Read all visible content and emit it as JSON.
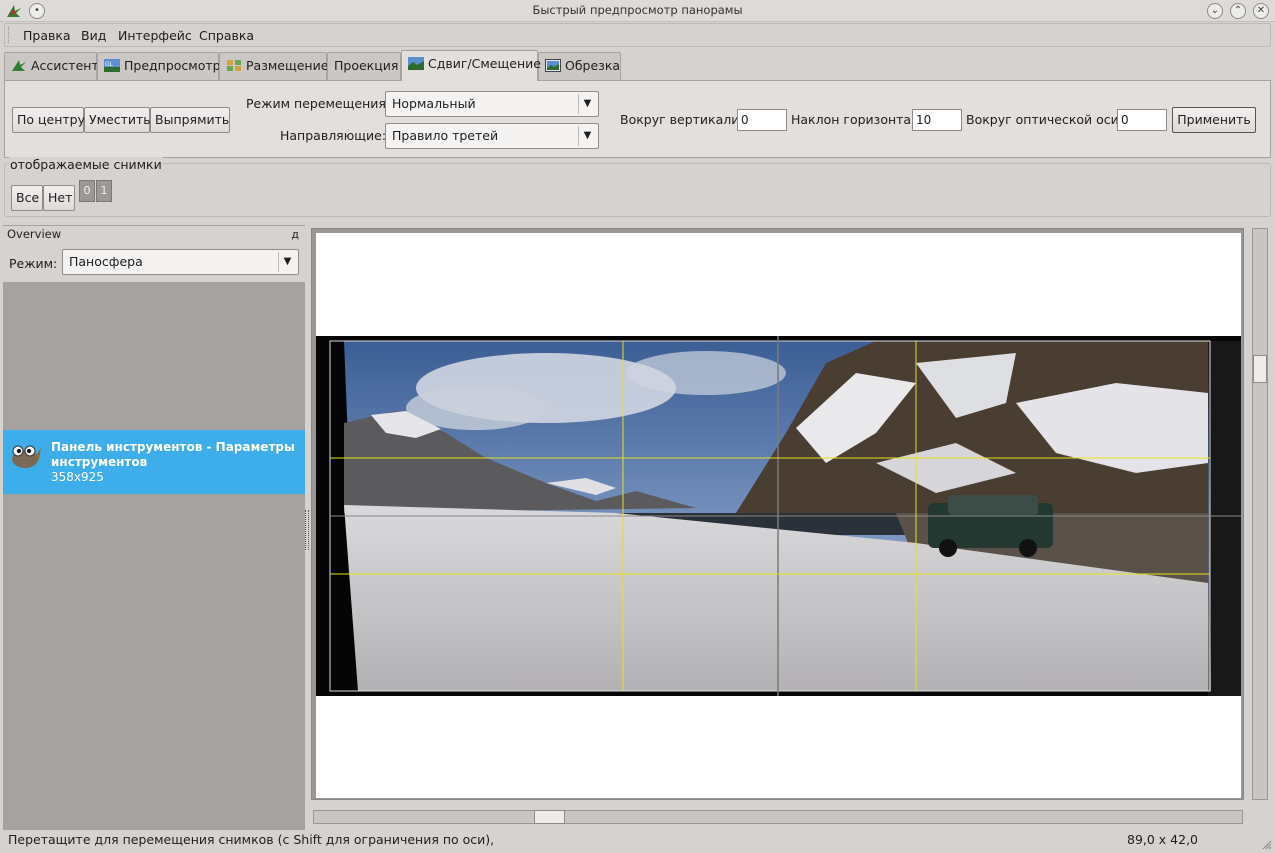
{
  "window": {
    "title": "Быстрый предпросмотр панорамы"
  },
  "menubar": {
    "items": [
      "Правка",
      "Вид",
      "Интерфейс",
      "Справка"
    ]
  },
  "tabs": [
    {
      "label": "Ассистент",
      "icon": "assistant-icon"
    },
    {
      "label": "Предпросмотр",
      "icon": "gl-preview-icon"
    },
    {
      "label": "Размещение",
      "icon": "layout-icon"
    },
    {
      "label": "Проекция",
      "icon": ""
    },
    {
      "label": "Сдвиг/Смещение",
      "icon": "move-drag-icon",
      "active": true
    },
    {
      "label": "Обрезка",
      "icon": "crop-icon"
    }
  ],
  "move": {
    "center_label": "По центру",
    "fit_label": "Уместить",
    "straighten_label": "Выпрямить",
    "drag_mode_label": "Режим перемещения:",
    "drag_mode_value": "Нормальный",
    "guides_label": "Направляющие:",
    "guides_value": "Правило третей",
    "yaw_label": "Вокруг вертикали:",
    "yaw_value": "0",
    "pitch_label": "Наклон горизонта:",
    "pitch_value": "10",
    "roll_label": "Вокруг оптической оси:",
    "roll_value": "0",
    "apply_label": "Применить"
  },
  "displayed_images": {
    "legend": "отображаемые снимки",
    "all_label": "Все",
    "none_label": "Нет",
    "images": [
      "0",
      "1"
    ]
  },
  "overview": {
    "title": "Overview",
    "pin": "д",
    "mode_label": "Режим:",
    "mode_value": "Паносфера"
  },
  "drag_item": {
    "title": "Панель инструментов - Параметры инструментов",
    "size": "358x925"
  },
  "status": {
    "message": "Перетащите для перемещения снимков (с Shift для ограничения по оси),",
    "coords": "89,0 x 42,0"
  },
  "colors": {
    "accent": "#3daee9",
    "guide_yellow": "#e8e020",
    "window_bg": "#d6d2d0"
  }
}
